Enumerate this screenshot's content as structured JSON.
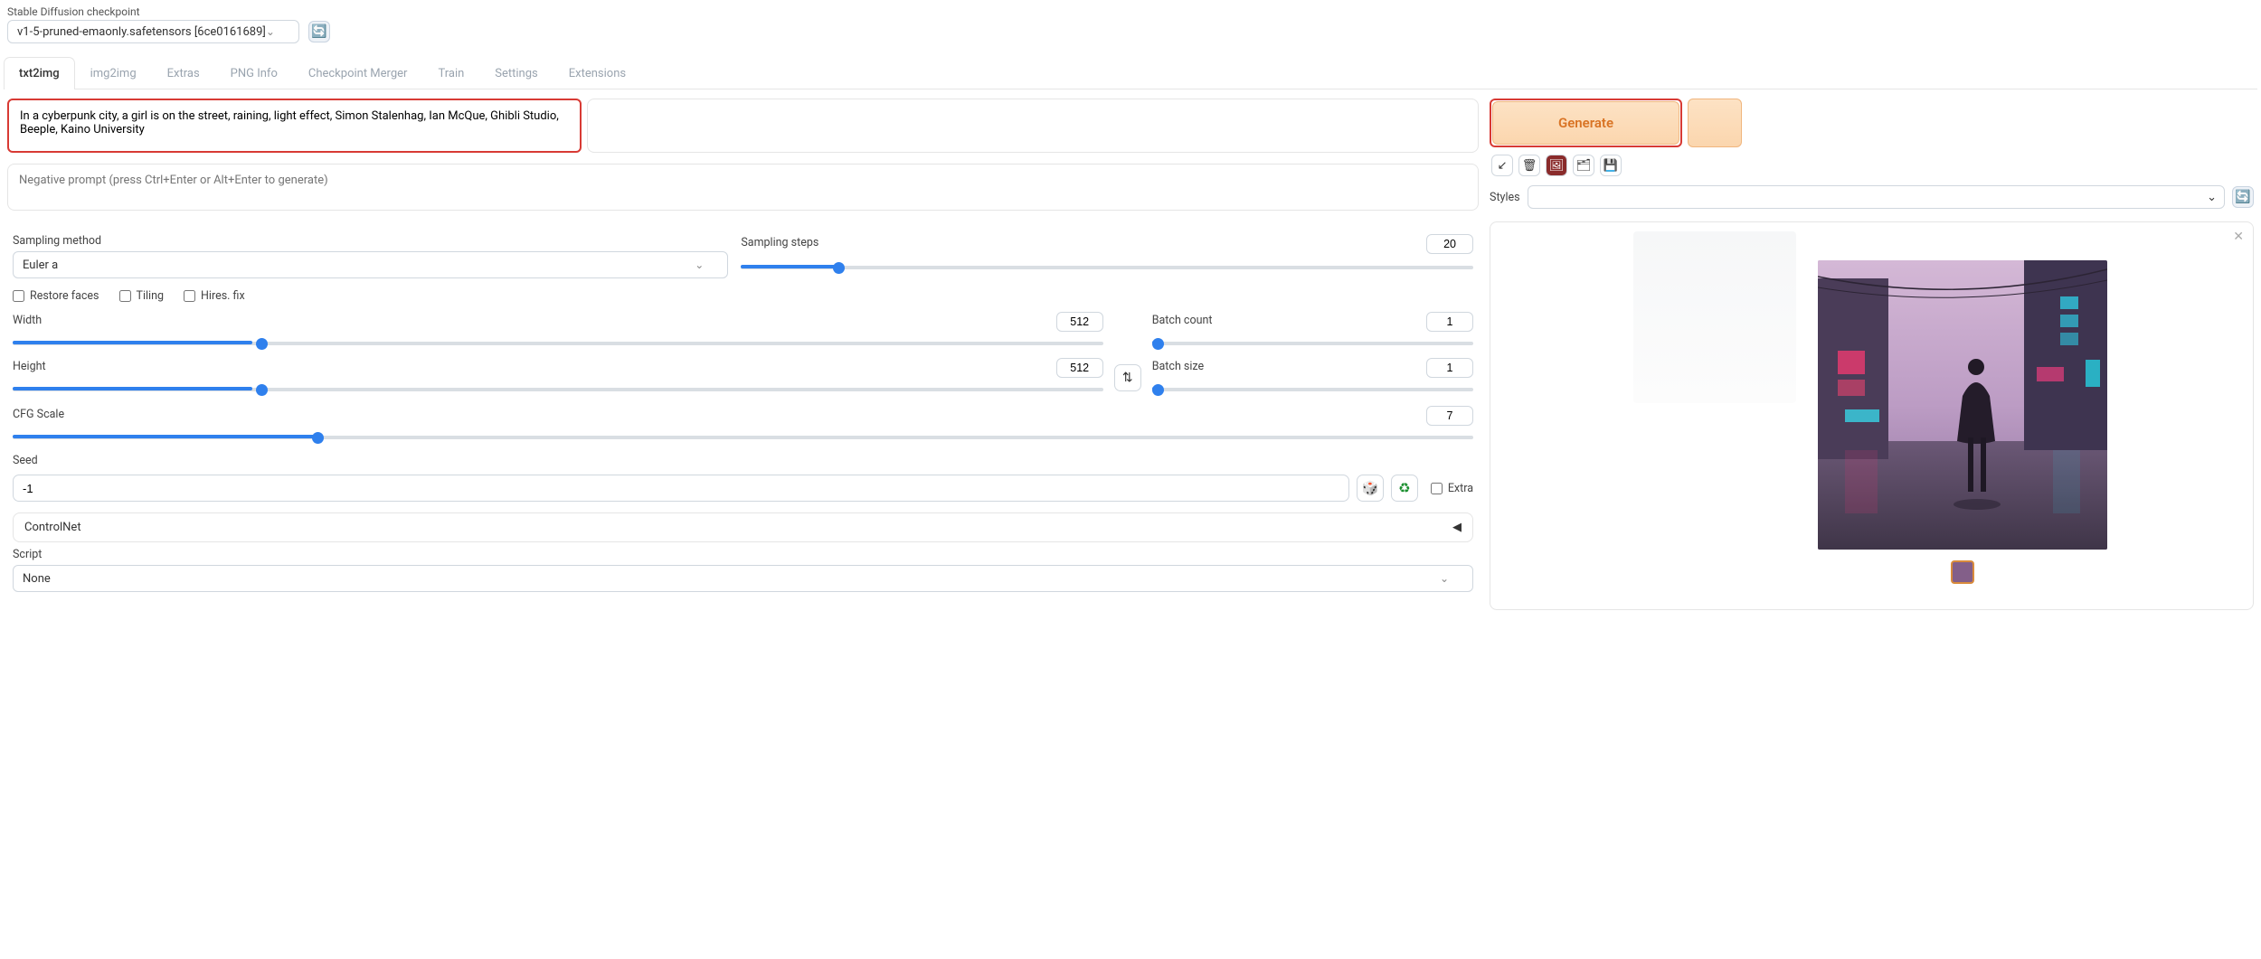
{
  "checkpoint": {
    "label": "Stable Diffusion checkpoint",
    "value": "v1-5-pruned-emaonly.safetensors [6ce0161689]"
  },
  "tabs": [
    "txt2img",
    "img2img",
    "Extras",
    "PNG Info",
    "Checkpoint Merger",
    "Train",
    "Settings",
    "Extensions"
  ],
  "active_tab": "txt2img",
  "prompt": "In a cyberpunk city, a girl is on the street, raining, light effect, Simon Stalenhag, Ian McQue, Ghibli Studio, Beeple, Kaino University",
  "negative_prompt_placeholder": "Negative prompt (press Ctrl+Enter or Alt+Enter to generate)",
  "generate_label": "Generate",
  "styles_label": "Styles",
  "sampling": {
    "method_label": "Sampling method",
    "method_value": "Euler a",
    "steps_label": "Sampling steps",
    "steps_value": "20"
  },
  "checks": {
    "restore_faces": "Restore faces",
    "tiling": "Tiling",
    "hires_fix": "Hires. fix"
  },
  "dims": {
    "width_label": "Width",
    "width_value": "512",
    "height_label": "Height",
    "height_value": "512"
  },
  "batch": {
    "count_label": "Batch count",
    "count_value": "1",
    "size_label": "Batch size",
    "size_value": "1"
  },
  "cfg": {
    "label": "CFG Scale",
    "value": "7"
  },
  "seed": {
    "label": "Seed",
    "value": "-1",
    "extra_label": "Extra"
  },
  "controlnet": {
    "label": "ControlNet"
  },
  "script": {
    "label": "Script",
    "value": "None"
  },
  "icons": {
    "arrow": "↙",
    "trash": "🗑",
    "card": "🖼",
    "folder": "🗂",
    "save": "💾",
    "recycle": "♻",
    "dice": "🎲",
    "swap": "⇅",
    "refresh": "🔄",
    "collapse": "◀",
    "chevron": "⌄",
    "close": "✕"
  }
}
